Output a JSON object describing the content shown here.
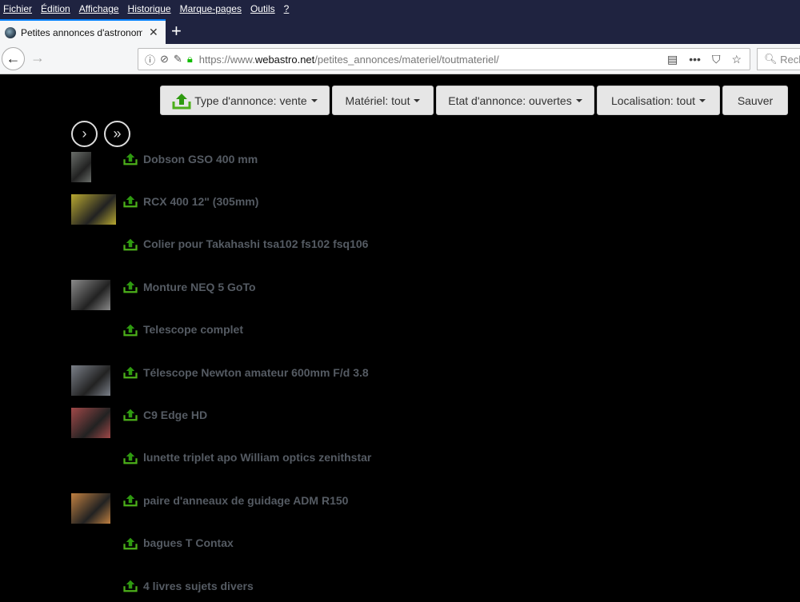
{
  "menu": [
    "Fichier",
    "Édition",
    "Affichage",
    "Historique",
    "Marque-pages",
    "Outils",
    "?"
  ],
  "tab": {
    "title": "Petites annonces d'astronomie",
    "close": "✕",
    "new": "+"
  },
  "url": {
    "prefix": "https://www.",
    "domain": "webastro.net",
    "path": "/petites_annonces/materiel/toutmateriel/"
  },
  "search_placeholder": "Rech",
  "filters": [
    {
      "label": "Type d'annonce: vente"
    },
    {
      "label": "Matériel: tout"
    },
    {
      "label": "Etat d'annonce: ouvertes"
    },
    {
      "label": "Localisation: tout"
    }
  ],
  "save_label": "Sauver",
  "pager": {
    "next": "›",
    "last": "»"
  },
  "items": [
    {
      "title": "Dobson GSO 400 mm",
      "thumb": "#6a6e6a"
    },
    {
      "title": "RCX 400 12\" (305mm)",
      "thumb": "#b8a830"
    },
    {
      "title": "Colier pour Takahashi tsa102 fs102 fsq106",
      "thumb": null
    },
    {
      "title": "Monture NEQ 5 GoTo",
      "thumb": "#8a8a8a"
    },
    {
      "title": "Telescope complet",
      "thumb": null
    },
    {
      "title": "Télescope Newton amateur 600mm F/d 3.8",
      "thumb": "#7a7f88"
    },
    {
      "title": "C9 Edge HD",
      "thumb": "#a04848"
    },
    {
      "title": "lunette triplet apo William optics zenithstar",
      "thumb": null
    },
    {
      "title": "paire d'anneaux de guidage ADM R150",
      "thumb": "#c08040"
    },
    {
      "title": "bagues T Contax",
      "thumb": null
    },
    {
      "title": "4 livres sujets divers",
      "thumb": null
    }
  ]
}
